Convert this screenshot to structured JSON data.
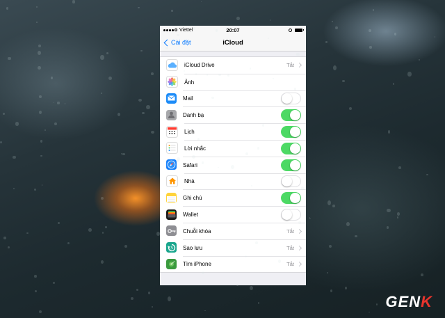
{
  "status_bar": {
    "carrier": "Viettel",
    "time": "20:07"
  },
  "nav": {
    "back_label": "Cài đặt",
    "title": "iCloud"
  },
  "rows": [
    {
      "label": "iCloud Drive",
      "icon": "icloud-drive-icon",
      "icon_color": "#ffffff",
      "control": "value",
      "value": "Tắt"
    },
    {
      "label": "Ảnh",
      "icon": "photos-icon",
      "icon_color": "#ffffff",
      "control": "toggle",
      "toggle_on": false,
      "hide_toggle": true
    },
    {
      "label": "Mail",
      "icon": "mail-icon",
      "icon_color": "#1d8cf8",
      "control": "toggle",
      "toggle_on": false
    },
    {
      "label": "Danh bạ",
      "icon": "contacts-icon",
      "icon_color": "#a7a8ab",
      "control": "toggle",
      "toggle_on": true
    },
    {
      "label": "Lịch",
      "icon": "calendar-icon",
      "icon_color": "#ffffff",
      "control": "toggle",
      "toggle_on": true
    },
    {
      "label": "Lời nhắc",
      "icon": "reminders-icon",
      "icon_color": "#ffffff",
      "control": "toggle",
      "toggle_on": true
    },
    {
      "label": "Safari",
      "icon": "safari-icon",
      "icon_color": "#1a82fb",
      "control": "toggle",
      "toggle_on": true
    },
    {
      "label": "Nhà",
      "icon": "home-icon",
      "icon_color": "#ffffff",
      "control": "toggle",
      "toggle_on": false
    },
    {
      "label": "Ghi chú",
      "icon": "notes-icon",
      "icon_color": "#ffd33a",
      "control": "toggle",
      "toggle_on": true
    },
    {
      "label": "Wallet",
      "icon": "wallet-icon",
      "icon_color": "#1c1c1c",
      "control": "toggle",
      "toggle_on": false
    },
    {
      "label": "Chuỗi khóa",
      "icon": "keychain-icon",
      "icon_color": "#8e8e93",
      "control": "value",
      "value": "Tắt"
    },
    {
      "label": "Sao lưu",
      "icon": "backup-icon",
      "icon_color": "#19a68d",
      "control": "value",
      "value": "Tắt"
    },
    {
      "label": "Tìm iPhone",
      "icon": "find-iphone-icon",
      "icon_color": "#3a9a3e",
      "control": "value",
      "value": "Tắt"
    }
  ],
  "watermark": {
    "text_main": "GEN",
    "text_accent": "K"
  },
  "colors": {
    "accent": "#0a7aff",
    "toggle_on": "#4cd964"
  }
}
